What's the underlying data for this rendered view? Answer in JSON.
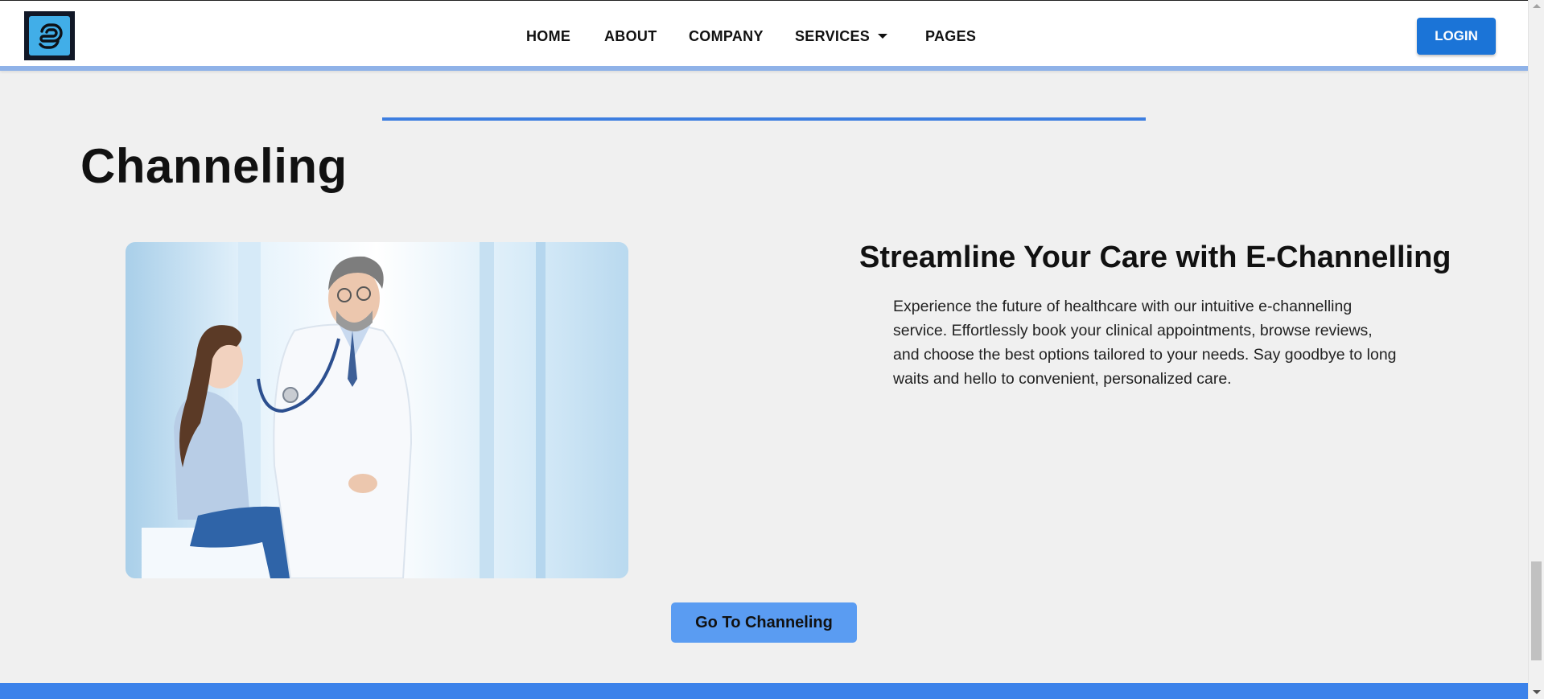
{
  "nav": {
    "items": [
      {
        "label": "HOME"
      },
      {
        "label": "ABOUT"
      },
      {
        "label": "COMPANY"
      },
      {
        "label": "SERVICES",
        "has_dropdown": true
      },
      {
        "label": "PAGES"
      }
    ],
    "login_label": "LOGIN",
    "login_color": "#1b74d7"
  },
  "section": {
    "title": "Channeling",
    "image_icon": "doctor-with-child-photo",
    "feature_title": "Streamline Your Care with E-Channelling",
    "feature_description": "Experience the future of healthcare with our intuitive e-channelling service. Effortlessly book your clinical appointments, browse reviews, and choose the best options tailored to your needs. Say goodbye to long waits and hello to convenient, personalized care.",
    "cta_label": "Go To Channeling",
    "cta_color": "#5a9cf2"
  },
  "theme": {
    "accent": "#3b82ea",
    "background": "#f0f0f0"
  }
}
